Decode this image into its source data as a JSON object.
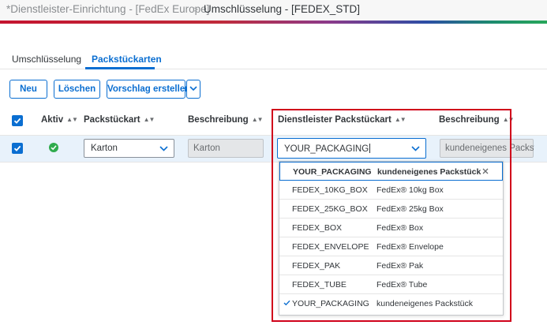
{
  "breadcrumb": {
    "parent": "*Dienstleister-Einrichtung - [FedEx Europe]",
    "separator": ">",
    "current": "Umschlüsselung - [FEDEX_STD]"
  },
  "tabs": [
    {
      "label": "Umschlüsselung",
      "active": false
    },
    {
      "label": "Packstückarten",
      "active": true
    }
  ],
  "toolbar": {
    "new_label": "Neu",
    "delete_label": "Löschen",
    "suggest_label": "Vorschlag erstellen"
  },
  "table": {
    "headers": {
      "active": "Aktiv",
      "package_type": "Packstückart",
      "description": "Beschreibung",
      "provider_package_type": "Dienstleister Packstückart",
      "provider_description": "Beschreibung"
    },
    "row": {
      "selected": true,
      "active": true,
      "package_type": "Karton",
      "description": "Karton",
      "provider_package_type": "YOUR_PACKAGING",
      "provider_description": "kundeneigenes Packstück"
    }
  },
  "dropdown": {
    "current": {
      "code": "YOUR_PACKAGING",
      "description": "kundeneigenes Packstück"
    },
    "options": [
      {
        "code": "FEDEX_10KG_BOX",
        "description": "FedEx® 10kg Box",
        "selected": false
      },
      {
        "code": "FEDEX_25KG_BOX",
        "description": "FedEx® 25kg Box",
        "selected": false
      },
      {
        "code": "FEDEX_BOX",
        "description": "FedEx® Box",
        "selected": false
      },
      {
        "code": "FEDEX_ENVELOPE",
        "description": "FedEx® Envelope",
        "selected": false
      },
      {
        "code": "FEDEX_PAK",
        "description": "FedEx® Pak",
        "selected": false
      },
      {
        "code": "FEDEX_TUBE",
        "description": "FedEx® Tube",
        "selected": false
      },
      {
        "code": "YOUR_PACKAGING",
        "description": "kundeneigenes Packstück",
        "selected": true
      }
    ]
  },
  "icons": {
    "breadcrumb_separator": "chevron-right-icon",
    "sort": "sort-icon",
    "dropdown": "chevron-down-icon",
    "clear": "close-icon",
    "selected": "check-icon",
    "status": "success-check-icon"
  },
  "colors": {
    "accent": "#0a6ed1",
    "highlight_box": "#d0021b",
    "status_ok": "#2fab4d",
    "row_selected": "#e8f2fb"
  }
}
